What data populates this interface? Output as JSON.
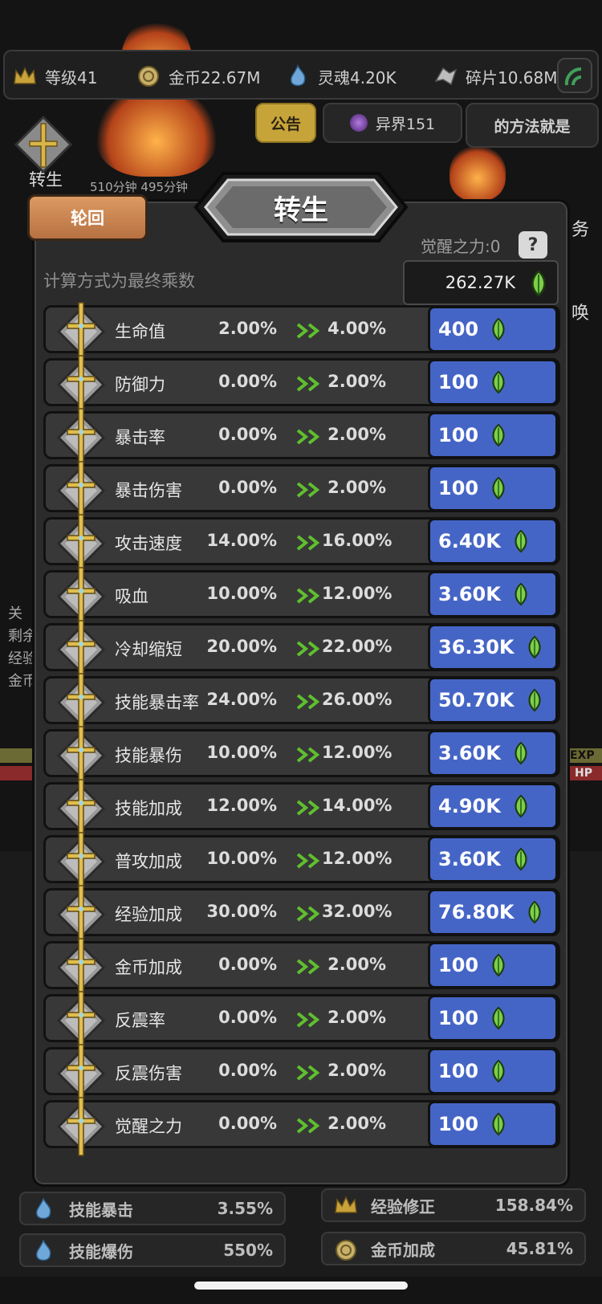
{
  "topbar": {
    "stats": [
      {
        "icon": "crown-icon",
        "label": "等级41"
      },
      {
        "icon": "coin-icon",
        "label": "金币22.67M"
      },
      {
        "icon": "soul-flame-icon",
        "label": "灵魂4.20K"
      },
      {
        "icon": "shard-icon",
        "label": "碎片10.68M"
      }
    ]
  },
  "header_tabs": {
    "notice": "公告",
    "otherworld": "异界151",
    "method": "的方法就是"
  },
  "background": {
    "left_label": "转生",
    "timer_text": "510分钟 495分钟",
    "right_fragment_1": "务",
    "right_fragment_2": "唤",
    "left_fragments": [
      "关",
      "剩余",
      "经验",
      "金币"
    ],
    "exp_label": "EXP",
    "hp_label": "HP",
    "bottom_stats": [
      {
        "icon": "blue-flame-icon",
        "label": "技能暴击",
        "value": "3.55%"
      },
      {
        "icon": "crown-icon",
        "label": "经验修正",
        "value": "158.84%"
      },
      {
        "icon": "blue-flame-icon",
        "label": "技能爆伤",
        "value": "550%"
      },
      {
        "icon": "coin-icon",
        "label": "金币加成",
        "value": "45.81%"
      }
    ]
  },
  "modal": {
    "title": "转生",
    "tab_label": "轮回",
    "awaken_label": "觉醒之力:0",
    "help_label": "?",
    "formula_text": "计算方式为最终乘数",
    "total_value": "262.27K",
    "rows": [
      {
        "name": "生命值",
        "from": "2.00%",
        "to": "4.00%",
        "cost": "400"
      },
      {
        "name": "防御力",
        "from": "0.00%",
        "to": "2.00%",
        "cost": "100"
      },
      {
        "name": "暴击率",
        "from": "0.00%",
        "to": "2.00%",
        "cost": "100"
      },
      {
        "name": "暴击伤害",
        "from": "0.00%",
        "to": "2.00%",
        "cost": "100"
      },
      {
        "name": "攻击速度",
        "from": "14.00%",
        "to": "16.00%",
        "cost": "6.40K"
      },
      {
        "name": "吸血",
        "from": "10.00%",
        "to": "12.00%",
        "cost": "3.60K"
      },
      {
        "name": "冷却缩短",
        "from": "20.00%",
        "to": "22.00%",
        "cost": "36.30K"
      },
      {
        "name": "技能暴击率",
        "from": "24.00%",
        "to": "26.00%",
        "cost": "50.70K"
      },
      {
        "name": "技能暴伤",
        "from": "10.00%",
        "to": "12.00%",
        "cost": "3.60K"
      },
      {
        "name": "技能加成",
        "from": "12.00%",
        "to": "14.00%",
        "cost": "4.90K"
      },
      {
        "name": "普攻加成",
        "from": "10.00%",
        "to": "12.00%",
        "cost": "3.60K"
      },
      {
        "name": "经验加成",
        "from": "30.00%",
        "to": "32.00%",
        "cost": "76.80K"
      },
      {
        "name": "金币加成",
        "from": "0.00%",
        "to": "2.00%",
        "cost": "100"
      },
      {
        "name": "反震率",
        "from": "0.00%",
        "to": "2.00%",
        "cost": "100"
      },
      {
        "name": "反震伤害",
        "from": "0.00%",
        "to": "2.00%",
        "cost": "100"
      },
      {
        "name": "觉醒之力",
        "from": "0.00%",
        "to": "2.00%",
        "cost": "100"
      }
    ]
  },
  "colors": {
    "buy_button": "#4565c6",
    "tab_orange": "#c9834f",
    "gem_green": "#7ccf4a",
    "arrow_green": "#5fbf2f",
    "notice_gold": "#c7a43a"
  }
}
